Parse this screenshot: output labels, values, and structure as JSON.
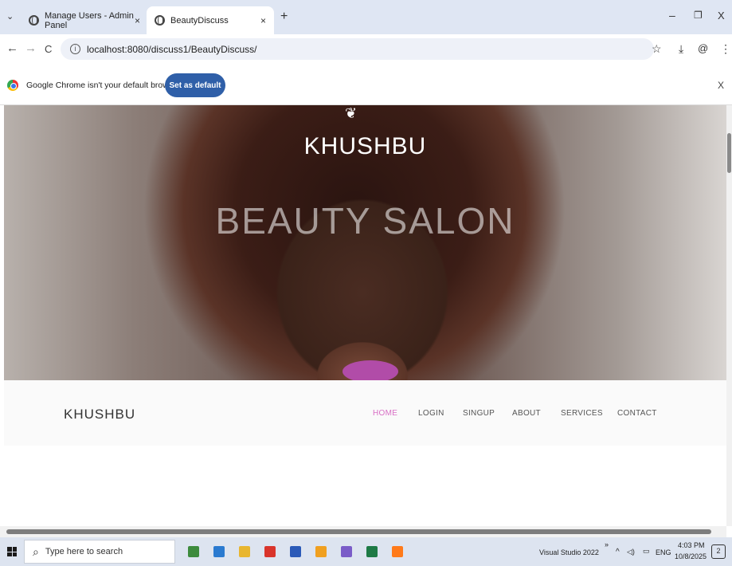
{
  "browser": {
    "tabs": [
      {
        "title": "Manage Users - Admin Panel",
        "close": "×"
      },
      {
        "title": "BeautyDiscuss",
        "close": "×"
      }
    ],
    "new_tab": "+",
    "tab_menu": "⌄",
    "window_controls": {
      "minimize": "–",
      "restore": "❐",
      "close": "X"
    },
    "nav": {
      "back": "←",
      "forward": "→",
      "reload": "C"
    },
    "url": "localhost:8080/discuss1/BeautyDiscuss/",
    "toolbar_icons": {
      "bookmark": "☆",
      "download": "⤓",
      "profile": "@",
      "menu": "⋮"
    },
    "infobar": {
      "message": "Google Chrome isn't your default browser",
      "button": "Set as default",
      "close": "X"
    }
  },
  "page": {
    "hero": {
      "logo_glyph": "❦",
      "brand": "KHUSHBU",
      "subtitle": "BEAUTY SALON"
    },
    "navbar": {
      "brand": "KHUSHBU",
      "links": [
        "HOME",
        "LOGIN",
        "SINGUP",
        "ABOUT",
        "SERVICES",
        "CONTACT"
      ],
      "active": "HOME",
      "active_color": "#d86fc5"
    }
  },
  "taskbar": {
    "search_placeholder": "Type here to search",
    "search_icon": "⌕",
    "pinned_apps": [
      {
        "name": "installer-icon",
        "color": "#3d8b3d"
      },
      {
        "name": "vscode-icon",
        "color": "#2a7ad0"
      },
      {
        "name": "file-explorer-icon",
        "color": "#e8b630"
      },
      {
        "name": "acrobat-icon",
        "color": "#d9342b"
      },
      {
        "name": "word-icon",
        "color": "#2b5ab8"
      },
      {
        "name": "chrome-icon",
        "color": "#f0a020"
      },
      {
        "name": "app-icon",
        "color": "#7a5cc8"
      },
      {
        "name": "excel-icon",
        "color": "#1e7a46"
      },
      {
        "name": "firefox-icon",
        "color": "#ff7a1a"
      }
    ],
    "running_app": "Visual Studio 2022",
    "overflow": "»",
    "tray": {
      "chevron": "^",
      "volume": "◁)",
      "network": "▭",
      "language": "ENG"
    },
    "time": "4:03 PM",
    "date": "10/8/2025",
    "notification_count": "2"
  }
}
